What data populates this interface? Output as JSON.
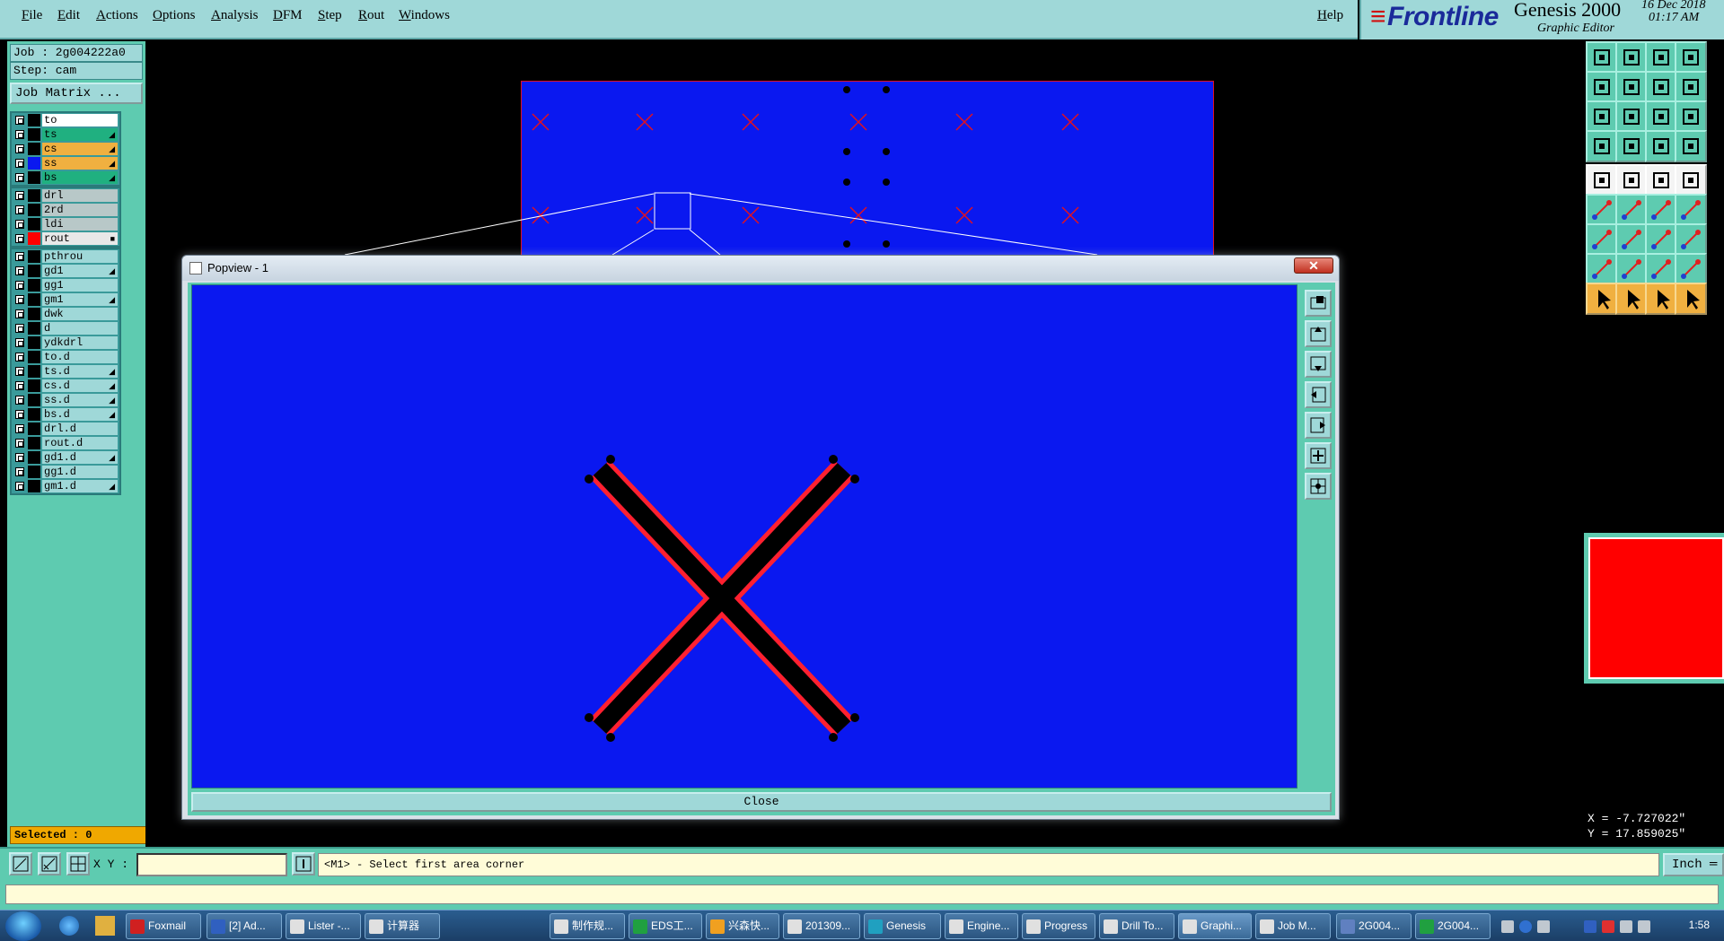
{
  "menubar": {
    "items": [
      "File",
      "Edit",
      "Actions",
      "Options",
      "Analysis",
      "DFM",
      "Step",
      "Rout",
      "Windows"
    ],
    "help": "Help"
  },
  "brand": {
    "logo": "Frontline",
    "product": "Genesis 2000",
    "subtitle": "Graphic Editor",
    "date": "16 Dec 2018",
    "time": "01:17 AM"
  },
  "job": {
    "job_label": "Job : 2g004222a0",
    "step_label": "Step: cam",
    "matrix_button": "Job Matrix ..."
  },
  "layers": {
    "group1": [
      {
        "name": "to",
        "color": "#000000",
        "bg": "#ffffff",
        "flag": ""
      },
      {
        "name": "ts",
        "color": "#000000",
        "bg": "#20b080",
        "flag": "◢"
      },
      {
        "name": "cs",
        "color": "#000000",
        "bg": "#f0b040",
        "flag": "◢"
      },
      {
        "name": "ss",
        "color": "#0a18f0",
        "bg": "#f0b040",
        "flag": "◢"
      },
      {
        "name": "bs",
        "color": "#000000",
        "bg": "#20b080",
        "flag": "◢"
      }
    ],
    "group2": [
      {
        "name": "drl",
        "color": "#000000",
        "bg": "#b8c8c8",
        "flag": ""
      },
      {
        "name": "2rd",
        "color": "#000000",
        "bg": "#b8c8c8",
        "flag": ""
      },
      {
        "name": "ldi",
        "color": "#000000",
        "bg": "#b8c8c8",
        "flag": ""
      },
      {
        "name": "rout",
        "color": "#ff0000",
        "bg": "#e8e8e8",
        "flag": "■"
      }
    ],
    "group3": [
      {
        "name": "pthrou",
        "color": "#000000",
        "bg": "#9fd8d8",
        "flag": ""
      },
      {
        "name": "gd1",
        "color": "#000000",
        "bg": "#9fd8d8",
        "flag": "◢"
      },
      {
        "name": "gg1",
        "color": "#000000",
        "bg": "#9fd8d8",
        "flag": ""
      },
      {
        "name": "gm1",
        "color": "#000000",
        "bg": "#9fd8d8",
        "flag": "◢"
      },
      {
        "name": "dwk",
        "color": "#000000",
        "bg": "#9fd8d8",
        "flag": ""
      },
      {
        "name": "d",
        "color": "#000000",
        "bg": "#9fd8d8",
        "flag": ""
      },
      {
        "name": "ydkdrl",
        "color": "#000000",
        "bg": "#9fd8d8",
        "flag": ""
      },
      {
        "name": "to.d",
        "color": "#000000",
        "bg": "#9fd8d8",
        "flag": ""
      },
      {
        "name": "ts.d",
        "color": "#000000",
        "bg": "#9fd8d8",
        "flag": "◢"
      },
      {
        "name": "cs.d",
        "color": "#000000",
        "bg": "#9fd8d8",
        "flag": "◢"
      },
      {
        "name": "ss.d",
        "color": "#000000",
        "bg": "#9fd8d8",
        "flag": "◢"
      },
      {
        "name": "bs.d",
        "color": "#000000",
        "bg": "#9fd8d8",
        "flag": "◢"
      },
      {
        "name": "drl.d",
        "color": "#000000",
        "bg": "#9fd8d8",
        "flag": ""
      },
      {
        "name": "rout.d",
        "color": "#000000",
        "bg": "#9fd8d8",
        "flag": ""
      },
      {
        "name": "gd1.d",
        "color": "#000000",
        "bg": "#9fd8d8",
        "flag": "◢"
      },
      {
        "name": "gg1.d",
        "color": "#000000",
        "bg": "#9fd8d8",
        "flag": ""
      },
      {
        "name": "gm1.d",
        "color": "#000000",
        "bg": "#9fd8d8",
        "flag": "◢"
      }
    ]
  },
  "selected": "Selected : 0",
  "popview": {
    "title": "Popview - 1",
    "close_x": "✕",
    "close_button": "Close"
  },
  "coords": {
    "x": "X = -7.727022\"",
    "y": "Y = 17.859025\""
  },
  "statusbar": {
    "xy_label": "X Y :",
    "xy_value": "",
    "prompt": "<M1> - Select first area corner",
    "units": "Inch ═"
  },
  "colors": {
    "panel": "#5ecbb0",
    "board": "#0a18f0",
    "rout": "#ff0000",
    "accent_teal": "#9fd8d8"
  },
  "taskbar": {
    "tasks": [
      {
        "label": "Foxmail",
        "color": "#d02020"
      },
      {
        "label": "[2] Ad...",
        "color": "#3060c0"
      },
      {
        "label": "Lister -...",
        "color": "#e0e0e0"
      },
      {
        "label": "计算器",
        "color": "#e0e0e0"
      },
      {
        "label": "制作规...",
        "color": "#e0e0e0"
      },
      {
        "label": "EDS工...",
        "color": "#20a040"
      },
      {
        "label": "兴森快...",
        "color": "#f0a020"
      },
      {
        "label": "201309...",
        "color": "#e0e0e0"
      },
      {
        "label": "Genesis",
        "color": "#20a0c0"
      },
      {
        "label": "Engine...",
        "color": "#e0e0e0"
      },
      {
        "label": "Progress",
        "color": "#e0e0e0"
      },
      {
        "label": "Drill To...",
        "color": "#e0e0e0"
      },
      {
        "label": "Graphi...",
        "color": "#e0e0e0"
      },
      {
        "label": "Job M...",
        "color": "#e0e0e0"
      },
      {
        "label": "2G004...",
        "color": "#6080c0"
      },
      {
        "label": "2G004...",
        "color": "#20a040"
      }
    ],
    "clock": "1:58"
  }
}
